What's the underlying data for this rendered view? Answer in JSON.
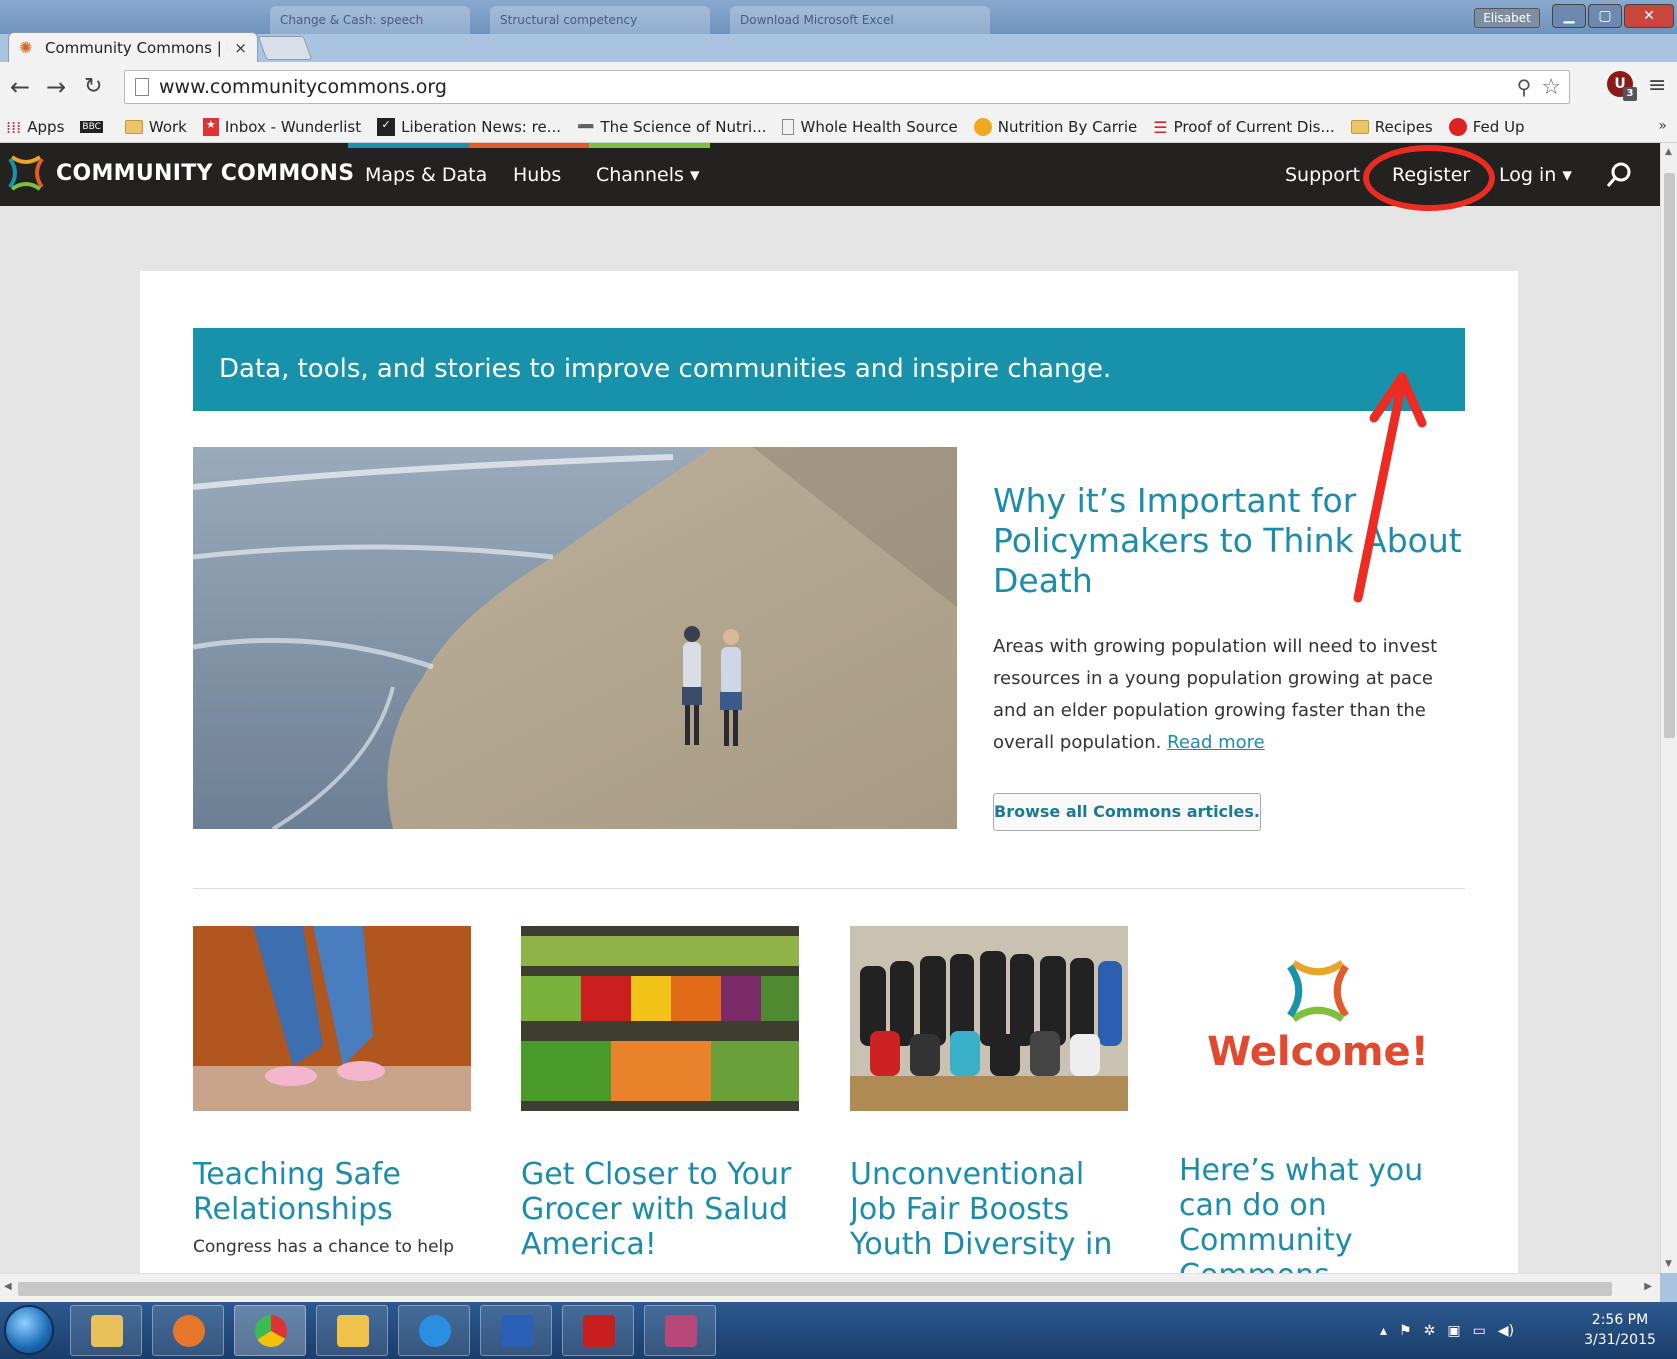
{
  "browser": {
    "user_badge": "Elisabet",
    "active_tab": {
      "title": "Community Commons | D",
      "close": "×"
    },
    "ghost_tabs": [
      "Change & Cash: speech",
      "Structural competency",
      "Download Microsoft Excel"
    ],
    "url": "www.communitycommons.org",
    "extension_label": "U",
    "extension_count": "3",
    "bookmarks": [
      {
        "label": "Apps",
        "icon": "apps-grid-icon"
      },
      {
        "label": "",
        "icon": "bbc-icon"
      },
      {
        "label": "Work",
        "icon": "folder-icon"
      },
      {
        "label": "Inbox - Wunderlist",
        "icon": "wunderlist-icon"
      },
      {
        "label": "Liberation News: re...",
        "icon": "liberation-news-icon"
      },
      {
        "label": "The Science of Nutri...",
        "icon": "nutrition-science-icon"
      },
      {
        "label": "Whole Health Source",
        "icon": "page-icon"
      },
      {
        "label": "Nutrition By Carrie",
        "icon": "carrie-icon"
      },
      {
        "label": "Proof of Current Dis...",
        "icon": "proof-icon"
      },
      {
        "label": "Recipes",
        "icon": "folder-icon"
      },
      {
        "label": "Fed Up",
        "icon": "fedup-icon"
      }
    ],
    "overflow": "»"
  },
  "site": {
    "logo_text": "COMMUNITY COMMONS",
    "nav": {
      "maps": "Maps & Data",
      "hubs": "Hubs",
      "channels": "Channels ▾",
      "support": "Support",
      "register": "Register",
      "login": "Log in ▾"
    },
    "strip_colors": [
      "#1a93a8",
      "#e35b2b",
      "#7fbf3e"
    ],
    "accent": "#1891ab",
    "annotation_color": "#ec2c23"
  },
  "content": {
    "banner": "Data, tools, and stories to improve communities and inspire change.",
    "hero": {
      "title": "Why it’s Important for Policymakers to Think About Death",
      "text": "Areas with growing population will need to invest resources in a young population growing at pace and an elder population growing faster than the overall population.",
      "read_more": "Read more",
      "browse": "Browse all Commons articles."
    },
    "tiles": [
      {
        "title": "Teaching Safe Relationships",
        "snippet": "Congress has a chance to help"
      },
      {
        "title": "Get Closer to Your Grocer with Salud America!",
        "snippet": ""
      },
      {
        "title": "Unconventional Job Fair Boosts Youth Diversity in Environmental",
        "snippet": ""
      },
      {
        "title": "Here’s what you can do on Community Commons",
        "snippet": "",
        "thumb_text": "Welcome!"
      }
    ]
  },
  "taskbar": {
    "time": "2:56 PM",
    "date": "3/31/2015"
  }
}
